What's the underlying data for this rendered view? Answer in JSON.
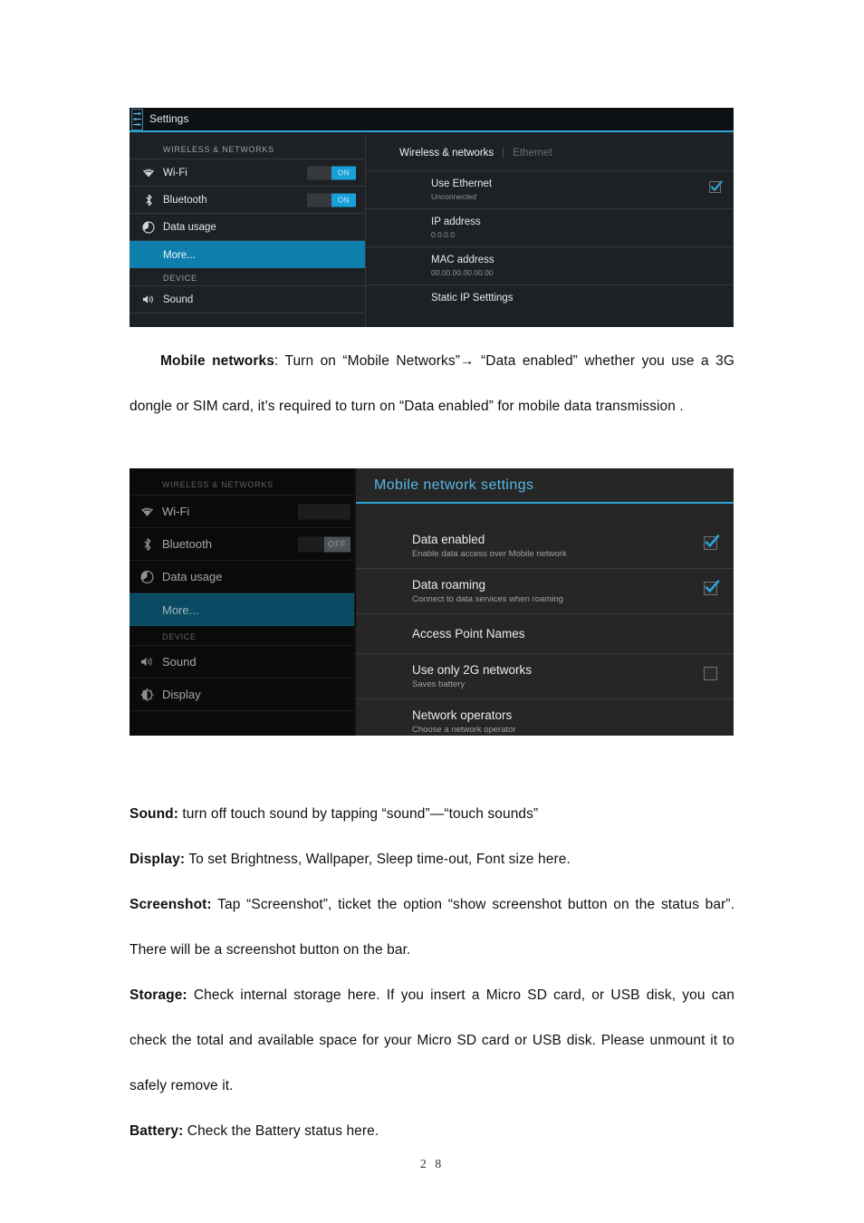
{
  "document": {
    "paragraphs": [
      {
        "id": "mobile-networks",
        "indent": true,
        "bold": "Mobile networks",
        "rest": ": Turn on “Mobile Networks”→ “Data enabled” whether you use a 3G dongle or SIM card, it’s required to turn on “Data enabled” for mobile data transmission ."
      },
      {
        "id": "sound",
        "indent": false,
        "bold": "Sound:",
        "rest": " turn off touch sound by tapping “sound”—“touch sounds”"
      },
      {
        "id": "display",
        "indent": false,
        "bold": "Display:",
        "rest": " To set Brightness, Wallpaper, Sleep time-out, Font size here."
      },
      {
        "id": "screenshot",
        "indent": false,
        "bold": "Screenshot:",
        "rest": " Tap “Screenshot”, ticket the option “show screenshot button on the status bar”. There will be a screenshot button on the bar."
      },
      {
        "id": "storage",
        "indent": false,
        "bold": "Storage:",
        "rest": " Check internal storage here. If you insert a Micro SD card, or USB disk, you can check the total and available space for your Micro SD card or USB disk. Please unmount it to safely remove it."
      },
      {
        "id": "battery",
        "indent": false,
        "bold": "Battery:",
        "rest": " Check the Battery status here."
      }
    ],
    "page_number": "2 8"
  },
  "screenshot1": {
    "titlebar": {
      "icon": "settings-sliders-icon",
      "label": "Settings"
    },
    "sidebar": {
      "section1_header": "WIRELESS & NETWORKS",
      "section2_header": "DEVICE",
      "items": [
        {
          "label": "Wi-Fi",
          "icon": "wifi-icon",
          "toggle": "ON",
          "toggle_state": "on",
          "selected": false
        },
        {
          "label": "Bluetooth",
          "icon": "bluetooth-icon",
          "toggle": "ON",
          "toggle_state": "on",
          "selected": false
        },
        {
          "label": "Data usage",
          "icon": "data-usage-icon",
          "toggle": null,
          "selected": false
        },
        {
          "label": "More...",
          "icon": null,
          "toggle": null,
          "selected": true
        },
        {
          "label": "Sound",
          "icon": "sound-icon",
          "toggle": null,
          "selected": false
        }
      ]
    },
    "pane": {
      "tab_active": "Wireless & networks",
      "tab_separator": "|",
      "tab_inactive": "Ethernet",
      "rows": [
        {
          "title": "Use Ethernet",
          "sub": "Unconnected",
          "checkbox": "checked"
        },
        {
          "title": "IP address",
          "sub": "0.0.0.0",
          "checkbox": null
        },
        {
          "title": "MAC address",
          "sub": "00.00.00.00.00.00",
          "checkbox": null
        },
        {
          "title": "Static IP Setttings",
          "sub": null,
          "checkbox": null
        }
      ]
    },
    "colors": {
      "accent": "#2aa4d6",
      "selected_row": "#0e7fad",
      "toggle_on": "#18a0d8"
    }
  },
  "screenshot2": {
    "sidebar": {
      "section1_header": "WIRELESS & NETWORKS",
      "section2_header": "DEVICE",
      "items": [
        {
          "label": "Wi-Fi",
          "icon": "wifi-icon",
          "toggle": "",
          "toggle_state": "blank",
          "selected": false
        },
        {
          "label": "Bluetooth",
          "icon": "bluetooth-icon",
          "toggle": "OFF",
          "toggle_state": "off",
          "selected": false
        },
        {
          "label": "Data usage",
          "icon": "data-usage-icon",
          "toggle": null,
          "selected": false
        },
        {
          "label": "More...",
          "icon": null,
          "toggle": null,
          "selected": true
        },
        {
          "label": "Sound",
          "icon": "sound-icon",
          "toggle": null,
          "selected": false
        },
        {
          "label": "Display",
          "icon": "display-icon",
          "toggle": null,
          "selected": false
        }
      ]
    },
    "pane": {
      "title": "Mobile network settings",
      "rows": [
        {
          "title": "Data enabled",
          "sub": "Enable data access over Mobile network",
          "checkbox": "checked"
        },
        {
          "title": "Data roaming",
          "sub": "Connect to data services when roaming",
          "checkbox": "checked"
        },
        {
          "title": "Access Point Names",
          "sub": null,
          "checkbox": null
        },
        {
          "title": "Use only 2G networks",
          "sub": "Saves battery",
          "checkbox": "unchecked"
        },
        {
          "title": "Network operators",
          "sub": "Choose a network operator",
          "checkbox": null
        }
      ]
    },
    "colors": {
      "accent": "#56b9e5",
      "selected_row": "#0a4a63",
      "toggle_off": "#4f5356"
    }
  }
}
